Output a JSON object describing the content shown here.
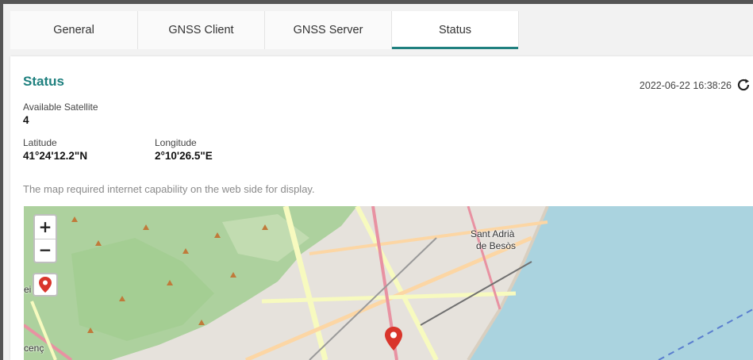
{
  "tabs": [
    {
      "label": "General"
    },
    {
      "label": "GNSS Client"
    },
    {
      "label": "GNSS Server"
    },
    {
      "label": "Status"
    }
  ],
  "status": {
    "title": "Status",
    "timestamp": "2022-06-22 16:38:26",
    "satellite_label": "Available Satellite",
    "satellite_value": "4",
    "latitude_label": "Latitude",
    "latitude_value": "41°24'12.2\"N",
    "longitude_label": "Longitude",
    "longitude_value": "2°10'26.5\"E",
    "map_note": "The map required internet capability on the web side for display."
  },
  "map": {
    "zoom_in": "+",
    "zoom_out": "−",
    "place_label_1": "Sant Adrià",
    "place_label_2": "de Besòs",
    "edge_label_1": "ei",
    "edge_label_2": "cenç"
  },
  "colors": {
    "accent": "#1f807f",
    "marker": "#d9352b",
    "sea": "#aad3df",
    "park": "#add19e"
  }
}
